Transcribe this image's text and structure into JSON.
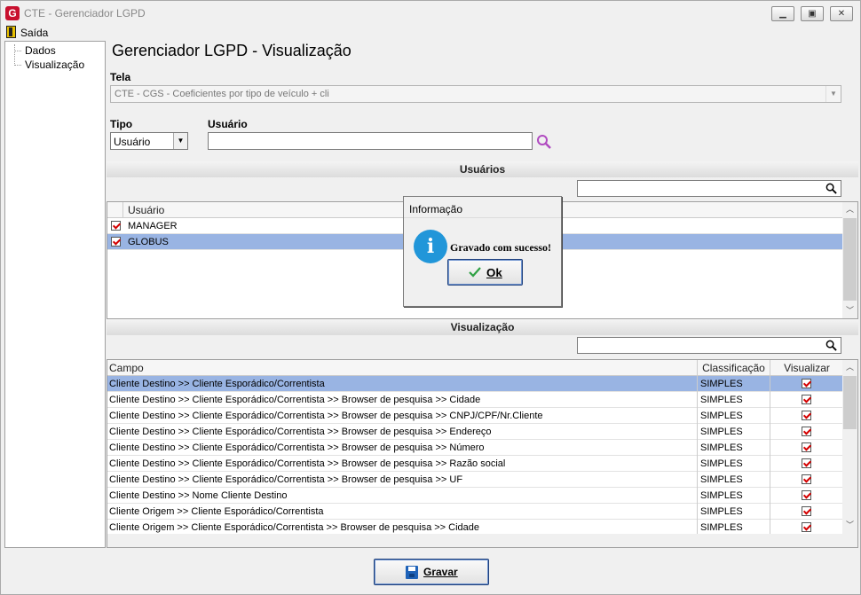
{
  "window": {
    "title": "CTE - Gerenciador LGPD",
    "logo_letter": "G"
  },
  "menu": {
    "exit_label": "Saída"
  },
  "tree": {
    "items": [
      "Dados",
      "Visualização"
    ]
  },
  "page_title": "Gerenciador LGPD - Visualização",
  "tela": {
    "label": "Tela",
    "value": "CTE - CGS - Coeficientes por tipo de veículo + cli"
  },
  "tipo": {
    "label": "Tipo",
    "value": "Usuário"
  },
  "usuario": {
    "label": "Usuário",
    "value": ""
  },
  "users_section": {
    "title": "Usuários",
    "column": "Usuário",
    "rows": [
      {
        "name": "MANAGER",
        "checked": true
      },
      {
        "name": "GLOBUS",
        "checked": true,
        "selected": true
      }
    ]
  },
  "visual_section": {
    "title": "Visualização",
    "columns": [
      "Campo",
      "Classificação",
      "Visualizar"
    ],
    "rows": [
      {
        "campo": "Cliente Destino >> Cliente Esporádico/Correntista",
        "classificacao": "SIMPLES",
        "visualizar": true
      },
      {
        "campo": "Cliente Destino >> Cliente Esporádico/Correntista >> Browser de pesquisa >> Cidade",
        "classificacao": "SIMPLES",
        "visualizar": true
      },
      {
        "campo": "Cliente Destino >> Cliente Esporádico/Correntista >> Browser de pesquisa >> CNPJ/CPF/Nr.Cliente",
        "classificacao": "SIMPLES",
        "visualizar": true
      },
      {
        "campo": "Cliente Destino >> Cliente Esporádico/Correntista >> Browser de pesquisa >> Endereço",
        "classificacao": "SIMPLES",
        "visualizar": true
      },
      {
        "campo": "Cliente Destino >> Cliente Esporádico/Correntista >> Browser de pesquisa >> Número",
        "classificacao": "SIMPLES",
        "visualizar": true
      },
      {
        "campo": "Cliente Destino >> Cliente Esporádico/Correntista >> Browser de pesquisa >> Razão social",
        "classificacao": "SIMPLES",
        "visualizar": true
      },
      {
        "campo": "Cliente Destino >> Cliente Esporádico/Correntista >> Browser de pesquisa >> UF",
        "classificacao": "SIMPLES",
        "visualizar": true
      },
      {
        "campo": "Cliente Destino >> Nome Cliente Destino",
        "classificacao": "SIMPLES",
        "visualizar": true
      },
      {
        "campo": "Cliente Origem >> Cliente Esporádico/Correntista",
        "classificacao": "SIMPLES",
        "visualizar": true
      },
      {
        "campo": "Cliente Origem >> Cliente Esporádico/Correntista >> Browser de pesquisa >> Cidade",
        "classificacao": "SIMPLES",
        "visualizar": true
      }
    ]
  },
  "save_button": {
    "label": "Gravar"
  },
  "dialog": {
    "title": "Informação",
    "message": "Gravado com sucesso!",
    "ok_label": "Ok",
    "icon": "info-icon"
  },
  "colors": {
    "selection": "#99b4e3",
    "accent": "#1e62b8",
    "check": "#d40000"
  }
}
